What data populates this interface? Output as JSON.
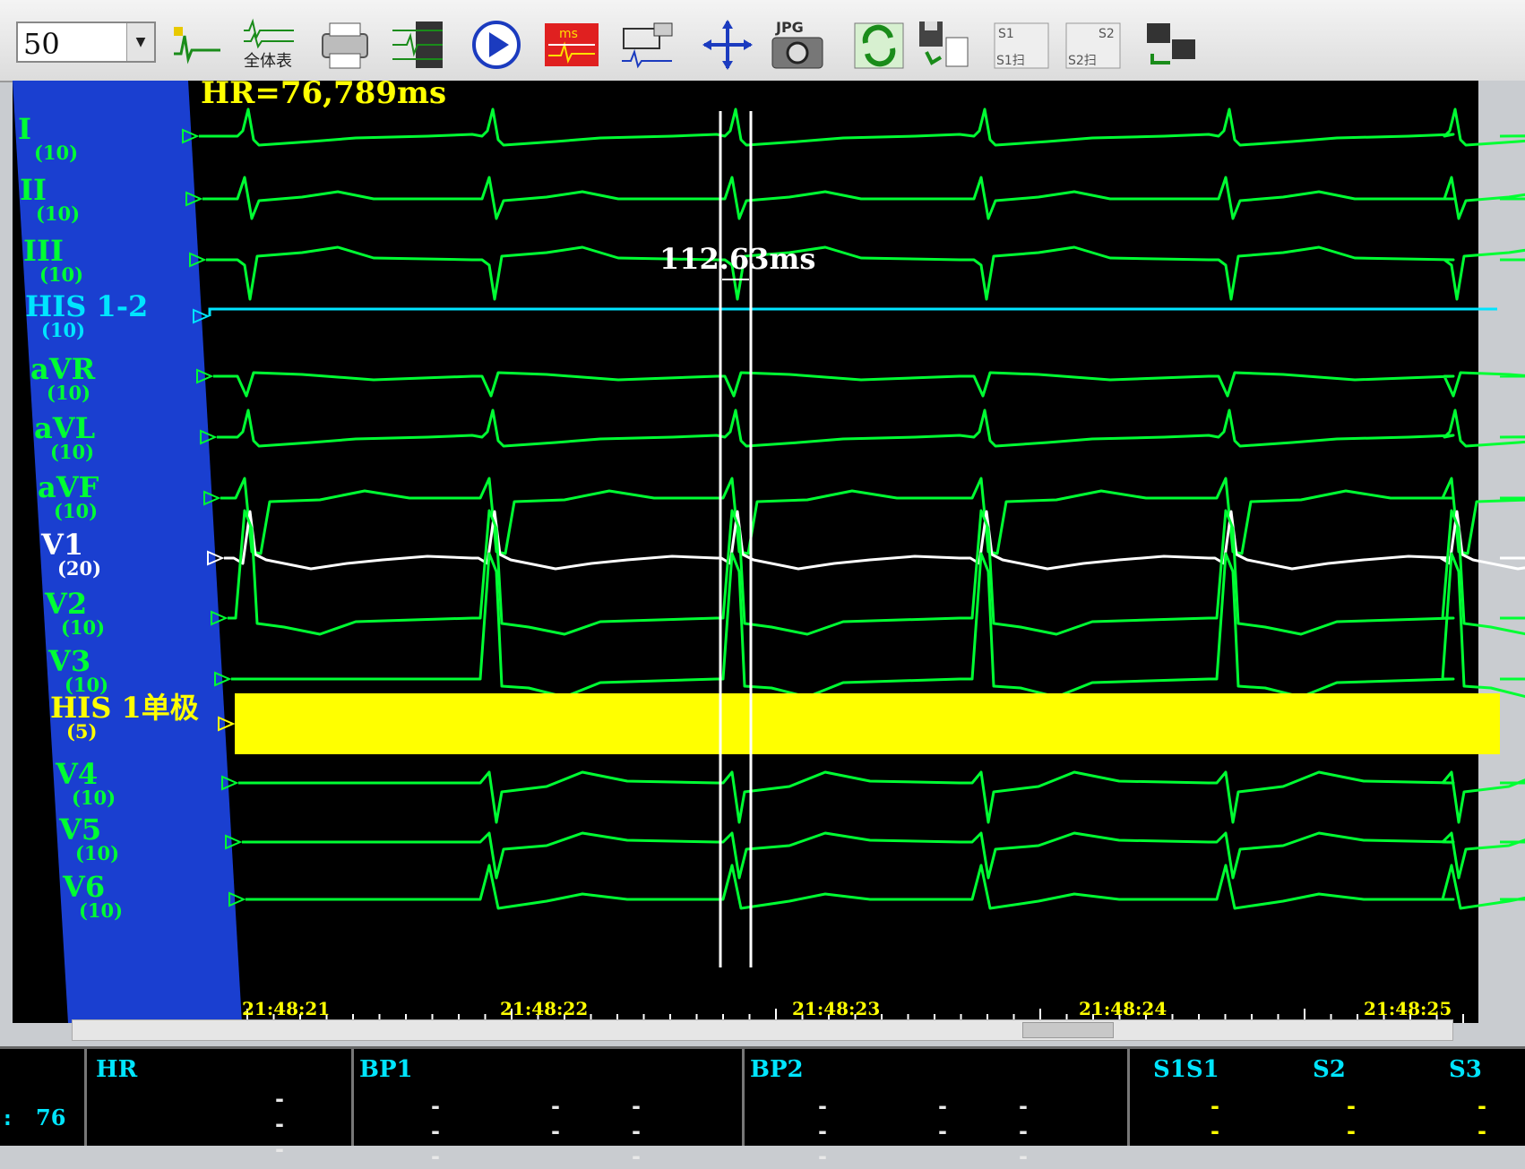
{
  "toolbar": {
    "speed_value": "50",
    "buttons": [
      {
        "name": "single-lead-icon",
        "label": ""
      },
      {
        "name": "full-display-icon",
        "label": "全体表"
      },
      {
        "name": "print-icon",
        "label": ""
      },
      {
        "name": "multi-lead-icon",
        "label": ""
      },
      {
        "name": "play-icon",
        "label": ""
      },
      {
        "name": "ms-caliper-icon",
        "label": "ms"
      },
      {
        "name": "stimulator-icon",
        "label": ""
      },
      {
        "name": "move-icon",
        "label": ""
      },
      {
        "name": "jpg-camera-icon",
        "label": "JPG"
      },
      {
        "name": "refresh-icon",
        "label": ""
      },
      {
        "name": "save-report-icon",
        "label": ""
      },
      {
        "name": "s1-scan-icon",
        "label": "S1"
      },
      {
        "name": "s2-scan-icon",
        "label": "S2"
      },
      {
        "name": "network-icon",
        "label": ""
      }
    ],
    "s1_sub": "S1扫",
    "s2_sub": "S2扫"
  },
  "overlay": {
    "hr_text": "HR=76,789ms",
    "measurement": "112.63ms"
  },
  "leads": [
    {
      "name": "I",
      "gain": "(10)",
      "color": "#00ff33"
    },
    {
      "name": "II",
      "gain": "(10)",
      "color": "#00ff33"
    },
    {
      "name": "III",
      "gain": "(10)",
      "color": "#00ff33"
    },
    {
      "name": "HIS 1-2",
      "gain": "(10)",
      "color": "#00e5ff"
    },
    {
      "name": "aVR",
      "gain": "(10)",
      "color": "#00ff33"
    },
    {
      "name": "aVL",
      "gain": "(10)",
      "color": "#00ff33"
    },
    {
      "name": "aVF",
      "gain": "(10)",
      "color": "#00ff33"
    },
    {
      "name": "V1",
      "gain": "(20)",
      "color": "#ffffff"
    },
    {
      "name": "V2",
      "gain": "(10)",
      "color": "#00ff33"
    },
    {
      "name": "V3",
      "gain": "(10)",
      "color": "#00ff33"
    },
    {
      "name": "HIS 1单极",
      "gain": "(5)",
      "color": "#ffff00"
    },
    {
      "name": "V4",
      "gain": "(10)",
      "color": "#00ff33"
    },
    {
      "name": "V5",
      "gain": "(10)",
      "color": "#00ff33"
    },
    {
      "name": "V6",
      "gain": "(10)",
      "color": "#00ff33"
    }
  ],
  "timestamps": [
    "21:48:21",
    "21:48:22",
    "21:48:23",
    "21:48:24",
    "21:48:25"
  ],
  "status": {
    "hr_label": "HR",
    "hr_value": "76",
    "hr_prefix": ":",
    "hr_dash": "---",
    "bp1_label": "BP1",
    "bp1_values": [
      "---",
      "--",
      "---"
    ],
    "bp2_label": "BP2",
    "bp2_values": [
      "---",
      "--",
      "---"
    ],
    "s1s1_label": "S1S1",
    "s1s1_value": "--",
    "s2_label": "S2",
    "s2_value": "--",
    "s3_label": "S3",
    "s3_value": "--"
  },
  "colors": {
    "lead_panel": "#1a3fd0",
    "ecg": "#00ff33",
    "his": "#00e5ff",
    "his_uni": "#ffff00",
    "overlay": "#ffff00"
  }
}
